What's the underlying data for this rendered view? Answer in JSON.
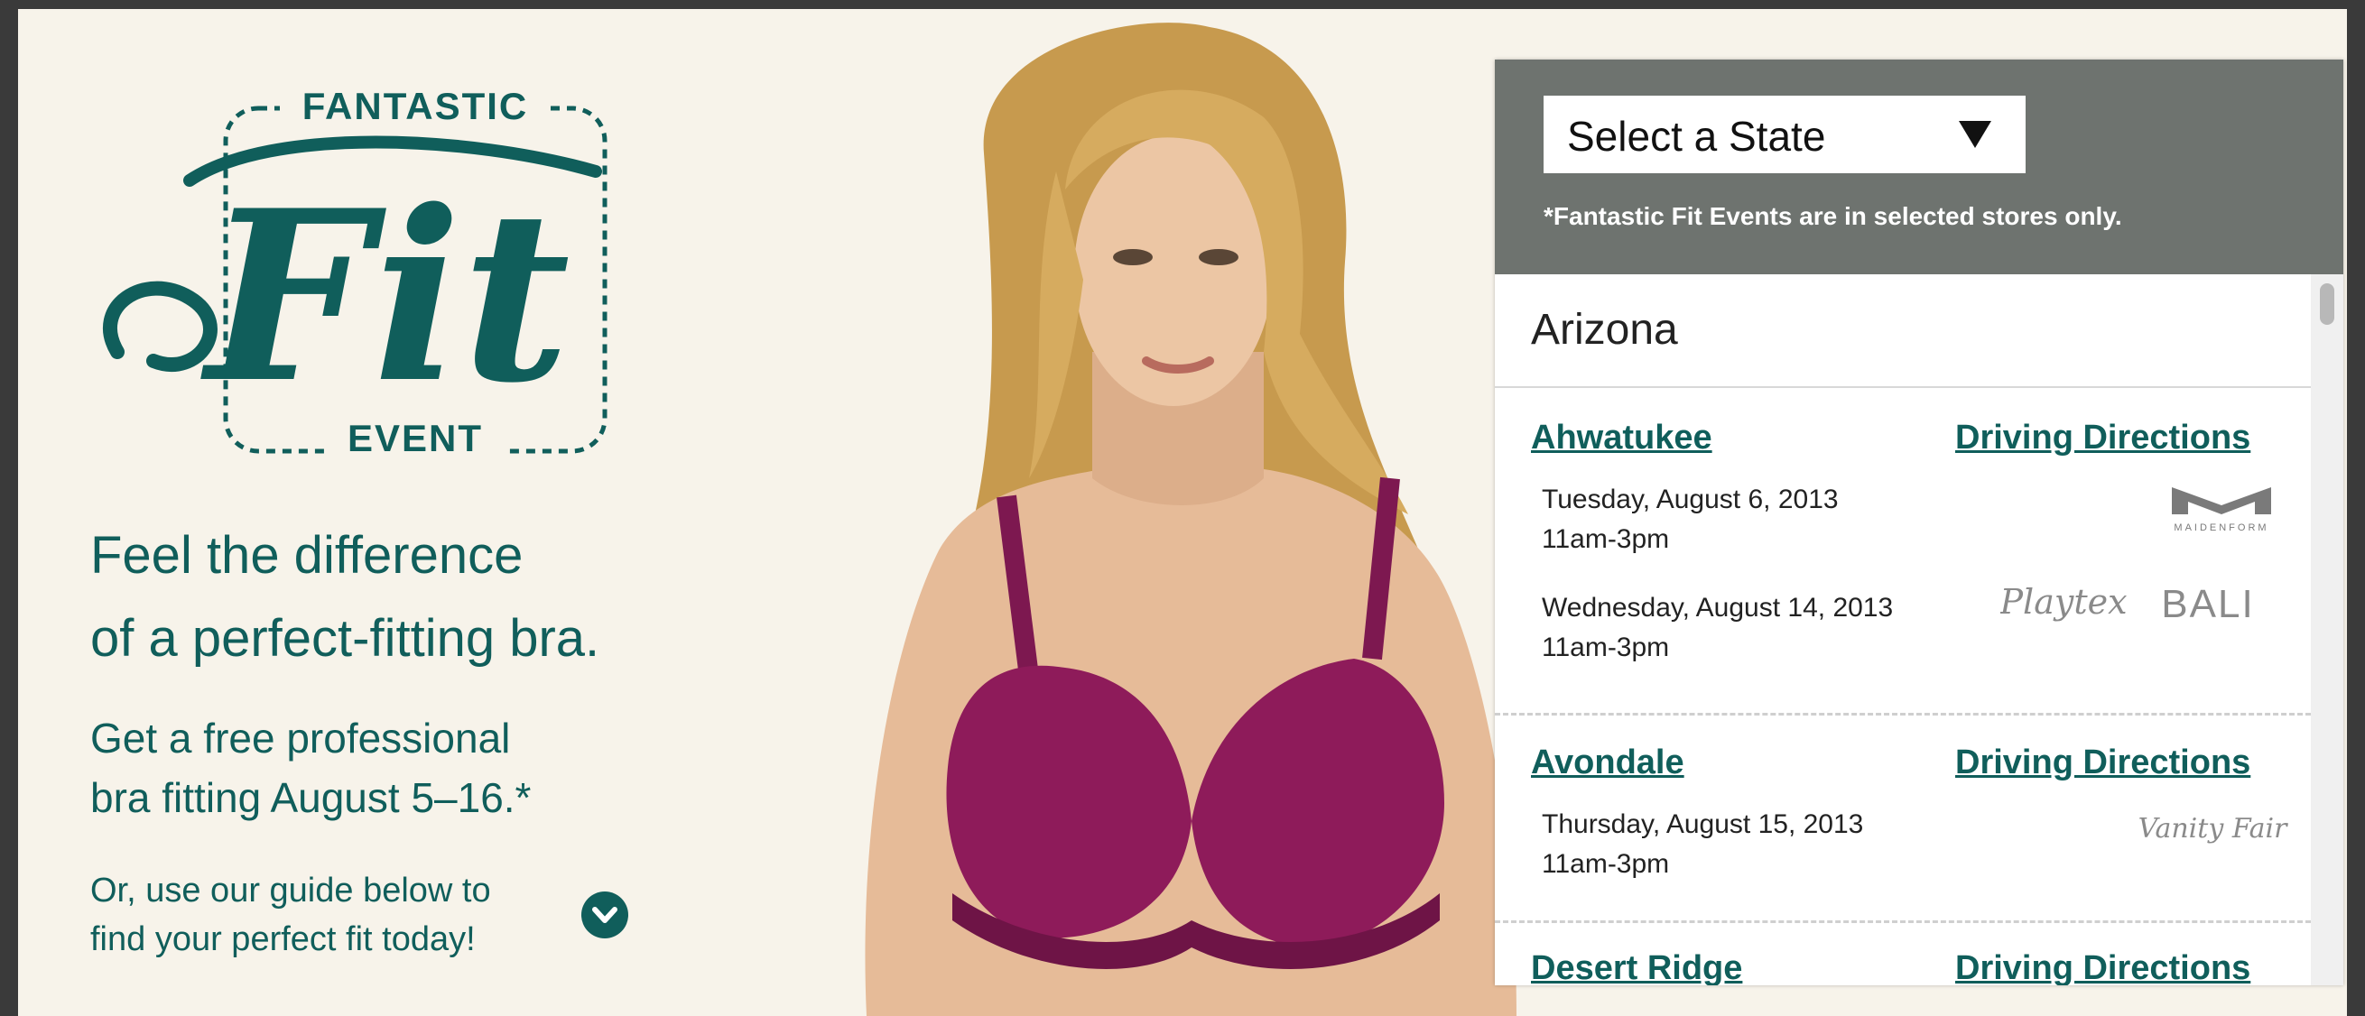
{
  "logo": {
    "top": "FANTASTIC",
    "script": "Fit",
    "bottom": "EVENT"
  },
  "hero": {
    "headline_line1": "Feel the difference",
    "headline_line2": "of a perfect-fitting bra.",
    "subhead_line1": "Get a free professional",
    "subhead_line2": "bra fitting August 5–16.*",
    "guide_line1": "Or, use our guide below to",
    "guide_line2": "find your perfect fit today!",
    "guide_button_icon": "chevron-down-icon"
  },
  "colors": {
    "brand_teal": "#105e5b",
    "panel_header": "#6e736f",
    "bra": "#8e1b5a",
    "background": "#f7f3ea"
  },
  "locator": {
    "select_label": "Select a State",
    "note": "*Fantastic Fit Events are in selected stores only.",
    "state": "Arizona",
    "stores": [
      {
        "name": "Ahwatukee",
        "directions": "Driving Directions",
        "events": [
          {
            "date": "Tuesday, August 6, 2013",
            "time": "11am-3pm",
            "brands": [
              "MAIDENFORM"
            ]
          },
          {
            "date": "Wednesday, August 14, 2013",
            "time": "11am-3pm",
            "brands": [
              "Playtex",
              "BALI"
            ]
          }
        ]
      },
      {
        "name": "Avondale",
        "directions": "Driving Directions",
        "events": [
          {
            "date": "Thursday, August 15, 2013",
            "time": "11am-3pm",
            "brands": [
              "Vanity Fair"
            ]
          }
        ]
      },
      {
        "name": "Desert Ridge",
        "directions": "Driving Directions",
        "events": []
      }
    ]
  }
}
